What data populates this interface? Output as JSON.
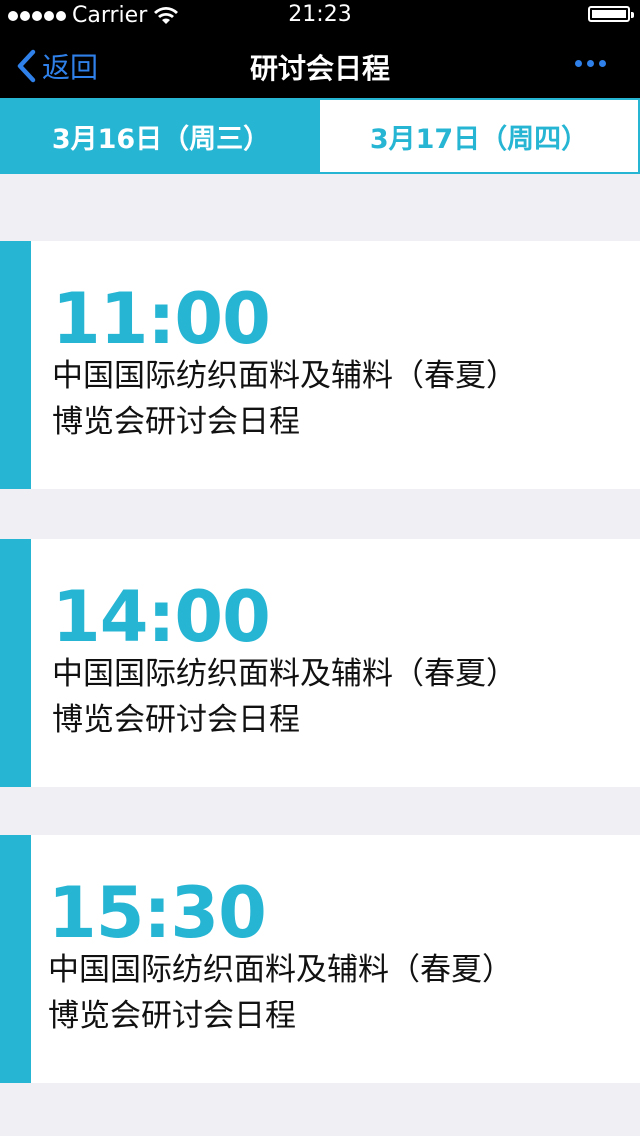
{
  "status_bar": {
    "carrier": "Carrier",
    "time": "21:23"
  },
  "navbar": {
    "back_label": "返回",
    "title": "研讨会日程"
  },
  "tabs": [
    {
      "label": "3月16日（周三）",
      "active": true
    },
    {
      "label": "3月17日（周四）",
      "active": false
    }
  ],
  "schedule": [
    {
      "time": "11:00",
      "desc_line1": "中国国际纺织面料及辅料（春夏）",
      "desc_line2": "博览会研讨会日程"
    },
    {
      "time": "14:00",
      "desc_line1": "中国国际纺织面料及辅料（春夏）",
      "desc_line2": "博览会研讨会日程"
    },
    {
      "time": "15:30",
      "desc_line1": "中国国际纺织面料及辅料（春夏）",
      "desc_line2": "博览会研讨会日程"
    }
  ],
  "colors": {
    "accent": "#27b5d4",
    "link": "#2f80e8",
    "background": "#efeff4"
  }
}
